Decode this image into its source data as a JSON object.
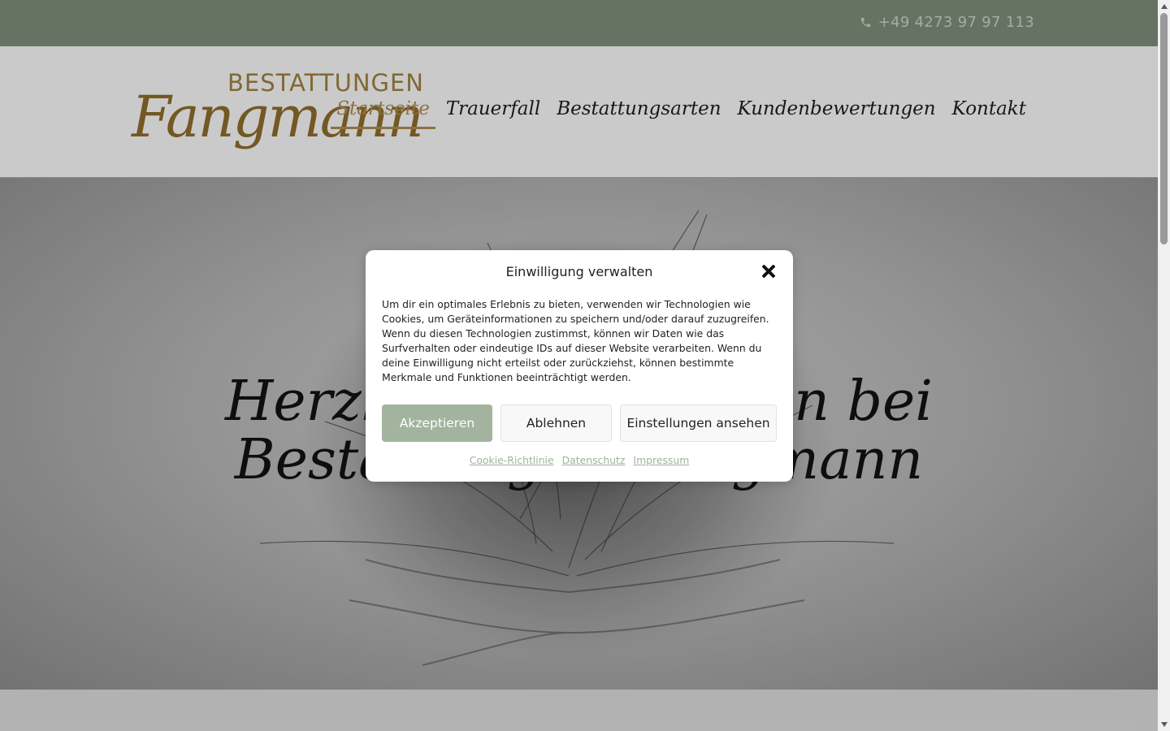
{
  "topbar": {
    "phone": "+49 4273 97 97 113",
    "phone_icon": "phone-icon"
  },
  "brand": {
    "logo_top": "BESTATTUNGEN",
    "logo_script": "Fangmann",
    "color": "#8c6a2b"
  },
  "nav": {
    "items": [
      {
        "label": "Startseite",
        "active": true
      },
      {
        "label": "Trauerfall",
        "active": false
      },
      {
        "label": "Bestattungsarten",
        "active": false
      },
      {
        "label": "Kundenbewertungen",
        "active": false
      },
      {
        "label": "Kontakt",
        "active": false
      }
    ]
  },
  "hero": {
    "title_line1": "Herzlich Willkommen bei",
    "title_line2": "Bestattungen Fangmann"
  },
  "consent": {
    "title": "Einwilligung verwalten",
    "close_icon": "close-icon",
    "text": "Um dir ein optimales Erlebnis zu bieten, verwenden wir Technologien wie Cookies, um Geräteinformationen zu speichern und/oder darauf zuzugreifen. Wenn du diesen Technologien zustimmst, können wir Daten wie das Surfverhalten oder eindeutige IDs auf dieser Website verarbeiten. Wenn du deine Einwilligung nicht erteilst oder zurückziehst, können bestimmte Merkmale und Funktionen beeinträchtigt werden.",
    "accept_label": "Akzeptieren",
    "deny_label": "Ablehnen",
    "settings_label": "Einstellungen ansehen",
    "links": [
      "Cookie-Richtlinie",
      "Datenschutz",
      "Impressum"
    ],
    "accent_color": "#a2b49e"
  },
  "colors": {
    "topbar": "#7b8b78",
    "nav_active": "#a88a4e"
  }
}
